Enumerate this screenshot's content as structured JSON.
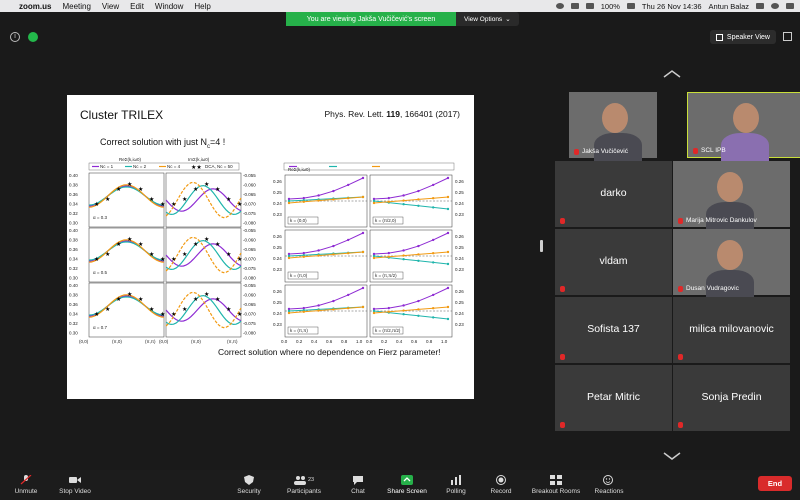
{
  "menubar": {
    "app_name": "zoom.us",
    "items": [
      "Meeting",
      "View",
      "Edit",
      "Window",
      "Help"
    ],
    "battery": "100%",
    "clock": "Thu 26 Nov  14:36",
    "user": "Antun Balaz"
  },
  "banner": {
    "text": "You are viewing Jakša Vučičević's screen",
    "view_options": "View Options"
  },
  "view": {
    "speaker_view": "Speaker View"
  },
  "slide": {
    "title": "Cluster TRILEX",
    "ref_prefix": "Phys. Rev. Lett. ",
    "ref_volume": "119",
    "ref_suffix": ", 166401 (2017)",
    "subtitle_prefix": "Correct solution with just N",
    "subtitle_sub": "c",
    "subtitle_suffix": "=4 !",
    "footnote": "Correct solution where no dependence on Fierz parameter!",
    "plot": {
      "header_left": "ReΣ(k,iω0)",
      "header_right": "ImΣ(k,iω0)",
      "alpha_labels": [
        "α = 0.3",
        "α = 0.5",
        "α = 0.7"
      ],
      "left_yticks": [
        "0.40",
        "0.38",
        "0.36",
        "0.34",
        "0.32",
        "0.30"
      ],
      "right_yticks": [
        "-0.055",
        "-0.060",
        "-0.065",
        "-0.070",
        "-0.075",
        "-0.080"
      ],
      "bottom_xticks": [
        "(0,0)",
        "(π,0)",
        "(π,π)",
        "(0,0)",
        "(π,0)",
        "(π,π)"
      ],
      "bottom_xlabel": "k",
      "small_yticks": [
        "0.26",
        "0.25",
        "0.24",
        "0.23"
      ],
      "small_xticks": [
        "0.0",
        "0.2",
        "0.4",
        "0.6",
        "0.8",
        "1.0",
        "0.0",
        "0.2",
        "0.4",
        "0.6",
        "0.8",
        "1.0"
      ],
      "small_xlabel": "α",
      "k_labels": [
        "k = (0,0)",
        "k = (π/2,0)",
        "k = (π,0)",
        "k = (π,π/2)",
        "k = (π,π)",
        "k = (π/2,π/2)"
      ],
      "legend": [
        "Nc = 1",
        "Nc = 2",
        "Nc = 4",
        "DCA, Nc = 50"
      ]
    }
  },
  "participants": [
    {
      "name": "Jakša Vučičević",
      "video": true
    },
    {
      "name": "SCL IPB",
      "video": true,
      "active": true
    },
    {
      "name": "darko",
      "video": false
    },
    {
      "name": "Marija Mitrovic Dankulov",
      "video": true
    },
    {
      "name": "vldam",
      "video": false
    },
    {
      "name": "Dusan Vudragovic",
      "video": true
    },
    {
      "name": "Sofista 137",
      "video": false
    },
    {
      "name": "milica milovanovic",
      "video": false
    },
    {
      "name": "Petar Mitric",
      "video": false
    },
    {
      "name": "Sonja Predin",
      "video": false
    }
  ],
  "toolbar": {
    "unmute": "Unmute",
    "stop_video": "Stop Video",
    "security": "Security",
    "participants": "Participants",
    "participants_count": "23",
    "chat": "Chat",
    "share_screen": "Share Screen",
    "polling": "Polling",
    "record": "Record",
    "breakout_rooms": "Breakout Rooms",
    "reactions": "Reactions",
    "end": "End"
  },
  "colors": {
    "share_green": "#26b14a",
    "end_red": "#d92b2b",
    "active_speaker": "#c9df3a",
    "series": [
      "#8e2bd3",
      "#1fb5ac",
      "#f29a12",
      "#000000"
    ]
  }
}
